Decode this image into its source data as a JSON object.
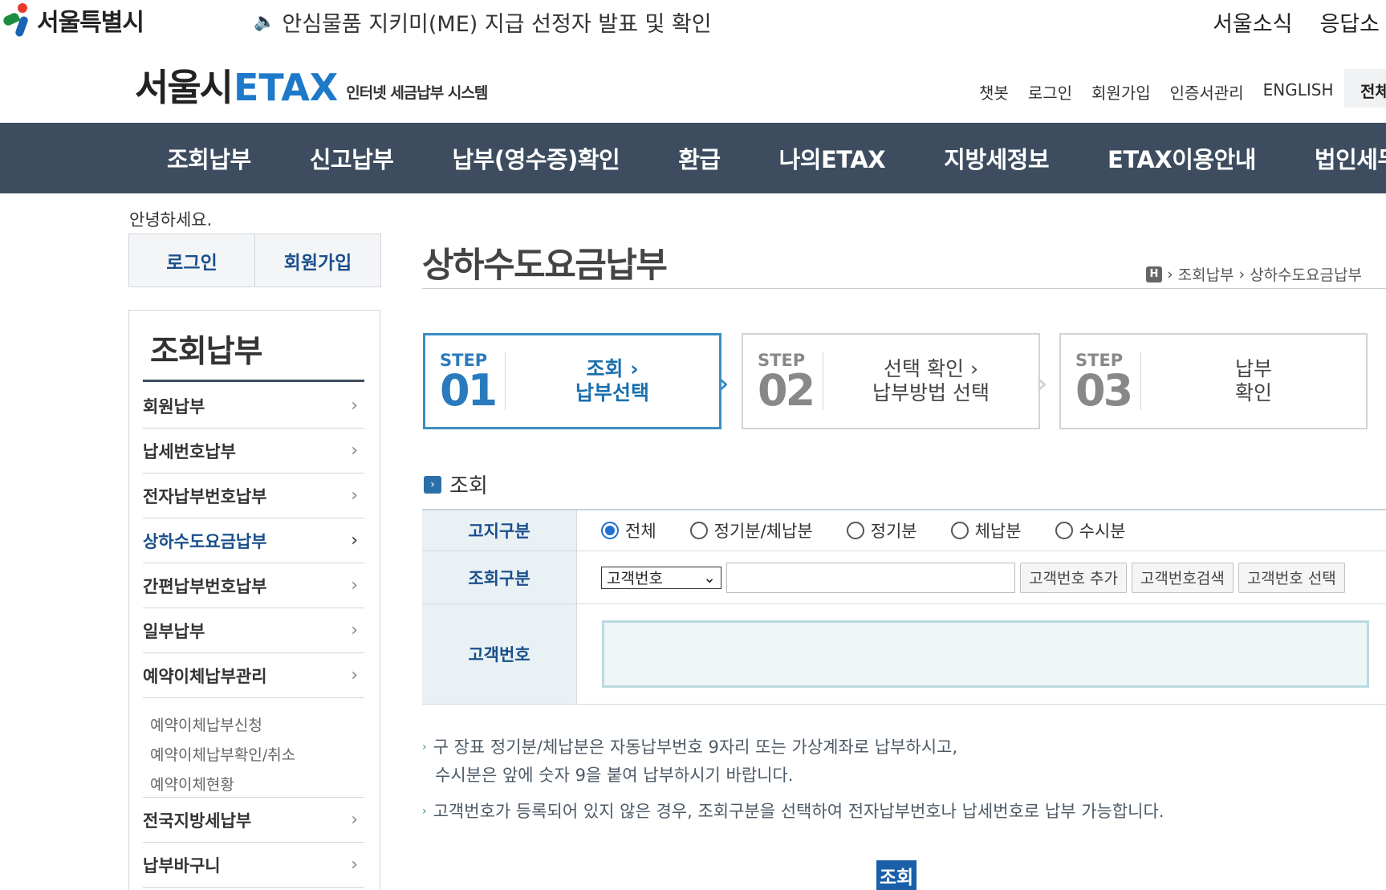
{
  "top": {
    "logo_text": "서울특별시",
    "notice": "안심물품 지키미(ME) 지급 선정자 발표 및 확인",
    "links": [
      "서울소식",
      "응답소"
    ]
  },
  "header": {
    "logo_main": "서울시",
    "logo_etax": "ETAX",
    "logo_sub": "인터넷 세금납부 시스템",
    "util_links": [
      "챗봇",
      "로그인",
      "회원가입",
      "인증서관리",
      "ENGLISH"
    ],
    "all_menu": "전체"
  },
  "main_nav": [
    "조회납부",
    "신고납부",
    "납부(영수증)확인",
    "환급",
    "나의ETAX",
    "지방세정보",
    "ETAX이용안내",
    "법인세무지"
  ],
  "sidebar": {
    "greeting": "안녕하세요.",
    "login": "로그인",
    "signup": "회원가입",
    "title": "조회납부",
    "items": [
      {
        "label": "회원납부",
        "active": false
      },
      {
        "label": "납세번호납부",
        "active": false
      },
      {
        "label": "전자납부번호납부",
        "active": false
      },
      {
        "label": "상하수도요금납부",
        "active": true
      },
      {
        "label": "간편납부번호납부",
        "active": false
      },
      {
        "label": "일부납부",
        "active": false
      },
      {
        "label": "예약이체납부관리",
        "active": false
      }
    ],
    "sub_items": [
      "예약이체납부신청",
      "예약이체납부확인/취소",
      "예약이체현황"
    ],
    "items_after": [
      "전국지방세납부",
      "납부바구니"
    ],
    "chevron": "›"
  },
  "content": {
    "page_title": "상하수도요금납부",
    "breadcrumb": {
      "home": "H",
      "items": [
        "조회납부",
        "상하수도요금납부"
      ],
      "sep": "›"
    },
    "steps": [
      {
        "label": "STEP",
        "num": "01",
        "line1": "조회 ›",
        "line2": "납부선택",
        "active": true
      },
      {
        "label": "STEP",
        "num": "02",
        "line1": "선택 확인 ›",
        "line2": "납부방법 선택",
        "active": false
      },
      {
        "label": "STEP",
        "num": "03",
        "line1": "납부",
        "line2": "확인",
        "active": false
      }
    ],
    "section_title": "조회",
    "form": {
      "notice_type_label": "고지구분",
      "notice_type_options": [
        "전체",
        "정기분/체납분",
        "정기분",
        "체납분",
        "수시분"
      ],
      "notice_type_selected": "전체",
      "query_type_label": "조회구분",
      "query_type_selected": "고객번호",
      "query_input_value": "",
      "btn_add": "고객번호 추가",
      "btn_search": "고객번호검색",
      "btn_select": "고객번호 선택",
      "customer_no_label": "고객번호",
      "customer_no_value": ""
    },
    "notes": [
      "구 장표 정기분/체납분은 자동납부번호 9자리 또는 가상계좌로 납부하시고,",
      "수시분은 앞에 숫자 9을 붙여 납부하시기 바랍니다.",
      "고객번호가 등록되어 있지 않은 경우, 조회구분을 선택하여 전자납부번호나 납세번호로 납부 가능합니다."
    ],
    "submit": "조회"
  },
  "colors": {
    "nav_bg": "#3d4d5f",
    "brand_blue": "#1f79c9",
    "label_blue": "#1a4f8b",
    "header_cell": "#e9f1f5"
  }
}
